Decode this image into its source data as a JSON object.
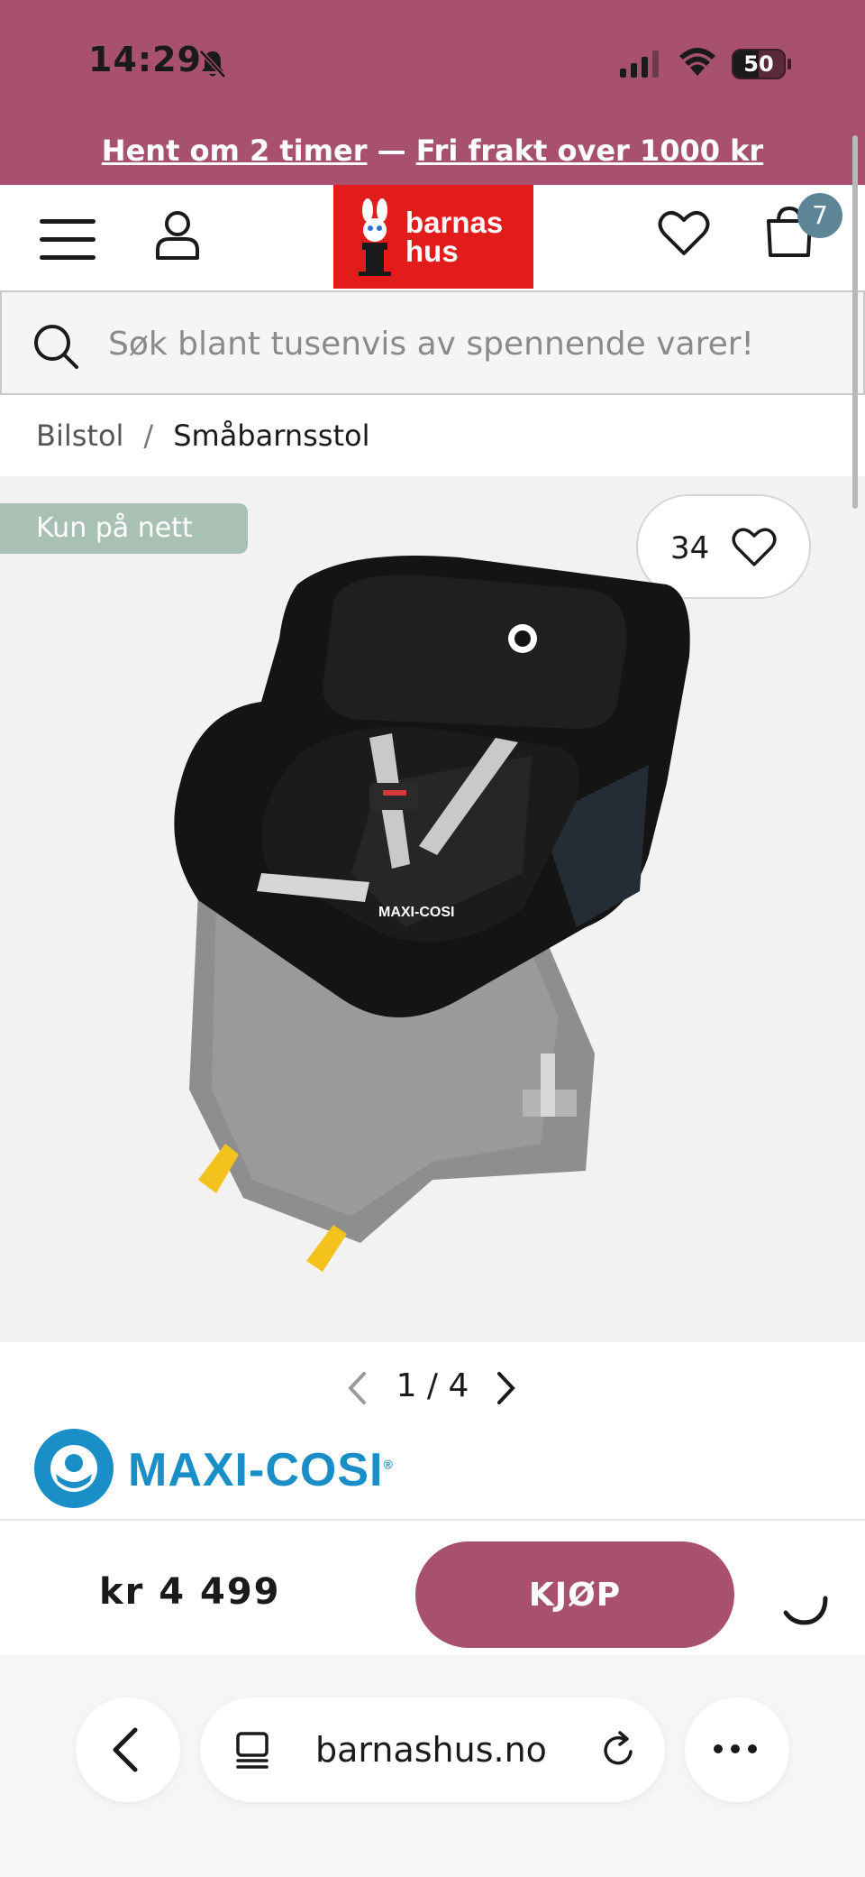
{
  "status_bar": {
    "time": "14:29",
    "battery": "50",
    "battery_level": 0.5
  },
  "promo": {
    "pickup": "Hent om 2 timer",
    "separator": " — ",
    "shipping": "Fri frakt over 1000 kr"
  },
  "header": {
    "logo_line1": "barnas",
    "logo_line2": "hus",
    "cart_count": "7"
  },
  "search": {
    "placeholder": "Søk blant tusenvis av spennende varer!"
  },
  "breadcrumb": {
    "items": [
      "Bilstol",
      "Småbarnsstol"
    ],
    "separator": "/"
  },
  "product": {
    "badge": "Kun på nett",
    "favorites_count": "34",
    "image_index": "1 / 4",
    "brand": "MAXI-COSI",
    "brand_mark": "®",
    "price": "kr 4 499",
    "buy_label": "KJØP"
  },
  "browser": {
    "url": "barnashus.no"
  },
  "colors": {
    "brand_pink": "#a8506f",
    "logo_red": "#e21b1b",
    "badge_green": "#a9c0b4",
    "maxi_cosi_blue": "#1a8ec6",
    "cart_badge": "#5e8595"
  },
  "icons": [
    "bell-slash-icon",
    "signal-icon",
    "wifi-icon",
    "battery-icon",
    "hamburger-icon",
    "user-icon",
    "heart-icon",
    "cart-icon",
    "search-icon",
    "chevron-left-icon",
    "chevron-right-icon",
    "spinner-icon",
    "back-icon",
    "tabs-icon",
    "reload-icon",
    "more-icon"
  ]
}
